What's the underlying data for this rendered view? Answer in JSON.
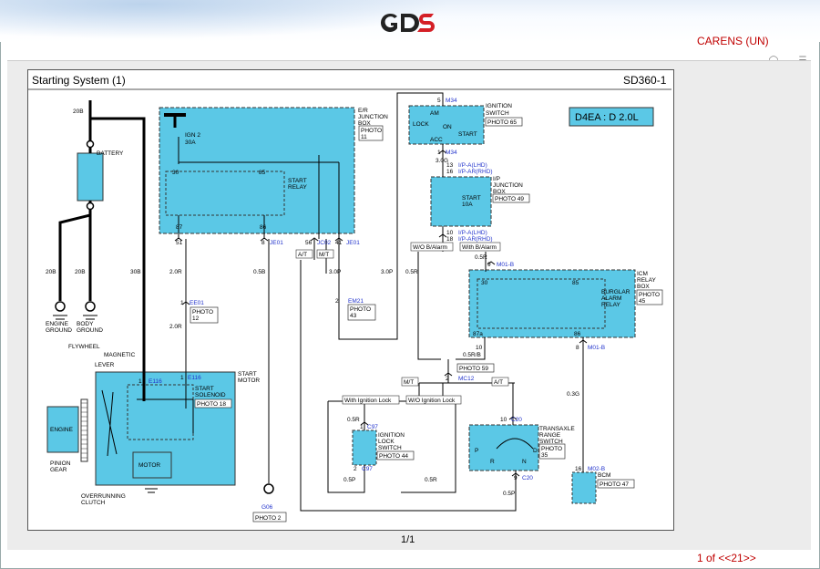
{
  "app": {
    "logo_text": "GDS",
    "vehicle": "CARENS (UN)",
    "page_indicator": "1 of <<21>>"
  },
  "sheet": {
    "title": "Starting System (1)",
    "code": "SD360-1",
    "pager": "1/1",
    "engine_badge": "D4EA : D 2.0L"
  },
  "colors": {
    "component_fill": "#5bc8e6",
    "brand_red": "#d41f26",
    "vehicle_red": "#c00000",
    "connector_blue": "#2233cc"
  },
  "labels": {
    "battery": "BATTERY",
    "er_box": [
      "E/R",
      "JUNCTION",
      "BOX"
    ],
    "photo11": [
      "PHOTO",
      "11"
    ],
    "ign2": [
      "IGN 2",
      "30A"
    ],
    "start_relay": [
      "START",
      "RELAY"
    ],
    "ign_switch": [
      "IGNITION",
      "SWITCH"
    ],
    "photo65": "PHOTO 65",
    "lock": "LOCK",
    "am": "AM",
    "on": "ON",
    "acc": "ACC",
    "start": "START",
    "ip_box": [
      "I/P",
      "JUNCTION",
      "BOX"
    ],
    "photo49": "PHOTO 49",
    "start10a": [
      "START",
      "10A"
    ],
    "icm_box": [
      "ICM",
      "RELAY",
      "BOX"
    ],
    "photo45": [
      "PHOTO",
      "45"
    ],
    "burglar": [
      "BURGLAR",
      "ALARM",
      "RELAY"
    ],
    "engine_ground": [
      "ENGINE",
      "GROUND"
    ],
    "body_ground": [
      "BODY",
      "GROUND"
    ],
    "flywheel": "FLYWHEEL",
    "magnetic": "MAGNETIC",
    "lever": "LEVER",
    "engine": "ENGINE",
    "pinion": [
      "PINION",
      "GEAR"
    ],
    "overrunning": [
      "OVERRUNNING",
      "CLUTCH"
    ],
    "motor": "MOTOR",
    "start_motor": [
      "START",
      "MOTOR"
    ],
    "start_solenoid": [
      "START",
      "SOLENOID"
    ],
    "photo18": "PHOTO 18",
    "photo12": [
      "PHOTO",
      "12"
    ],
    "photo43": [
      "PHOTO",
      "43"
    ],
    "photo2": "PHOTO 2",
    "photo59": "PHOTO 59",
    "photo44": "PHOTO 44",
    "photo35": [
      "PHOTO",
      "35"
    ],
    "photo47": "PHOTO 47",
    "ign_lock_sw": [
      "IGNITION",
      "LOCK",
      "SWITCH"
    ],
    "transaxle": [
      "TRANSAXLE",
      "RANGE",
      "SWITCH"
    ],
    "bcm": "BCM",
    "w_o_alarm": "W/O B/Alarm",
    "with_alarm": "With B/Alarm",
    "at": "A/T",
    "mt": "M/T",
    "with_ign_lock": "With Ignition Lock",
    "wo_ign_lock": "W/O Ignition Lock",
    "p": "P",
    "r": "R",
    "n": "N",
    "d": "D"
  },
  "connectors": {
    "m34": "M34",
    "je01": "JE01",
    "jc02": "JC02",
    "ee01": "EE01",
    "e116": "E116",
    "em21": "EM21",
    "g06": "G06",
    "m01b": "M01-B",
    "mc12": "MC12",
    "c97": "C97",
    "c20": "C20",
    "m02b": "M02-B",
    "ip_a_lhd": "I/P-A(LHD)",
    "ip_ar_rhd": "I/P-AR(RHD)"
  },
  "wires": {
    "w20b": "20B",
    "w30b": "30B",
    "w2_0r": "2.0R",
    "w0_5b": "0.5B",
    "w3_0p": "3.0P",
    "w3_0g": "3.0G",
    "w0_5r": "0.5R",
    "w0_5r_b": "0.5R/B",
    "w0_3g": "0.3G",
    "w0_5p": "0.5P"
  },
  "pins": {
    "p30": "30",
    "p85": "85",
    "p87": "87",
    "p86": "86",
    "p87a": "87a",
    "p51": "51",
    "p8": "8",
    "p56": "56",
    "p41": "41",
    "p1": "1",
    "p2": "2",
    "p5": "5",
    "p9": "9",
    "p10": "10",
    "p13": "13",
    "p16": "16",
    "p18": "18"
  }
}
